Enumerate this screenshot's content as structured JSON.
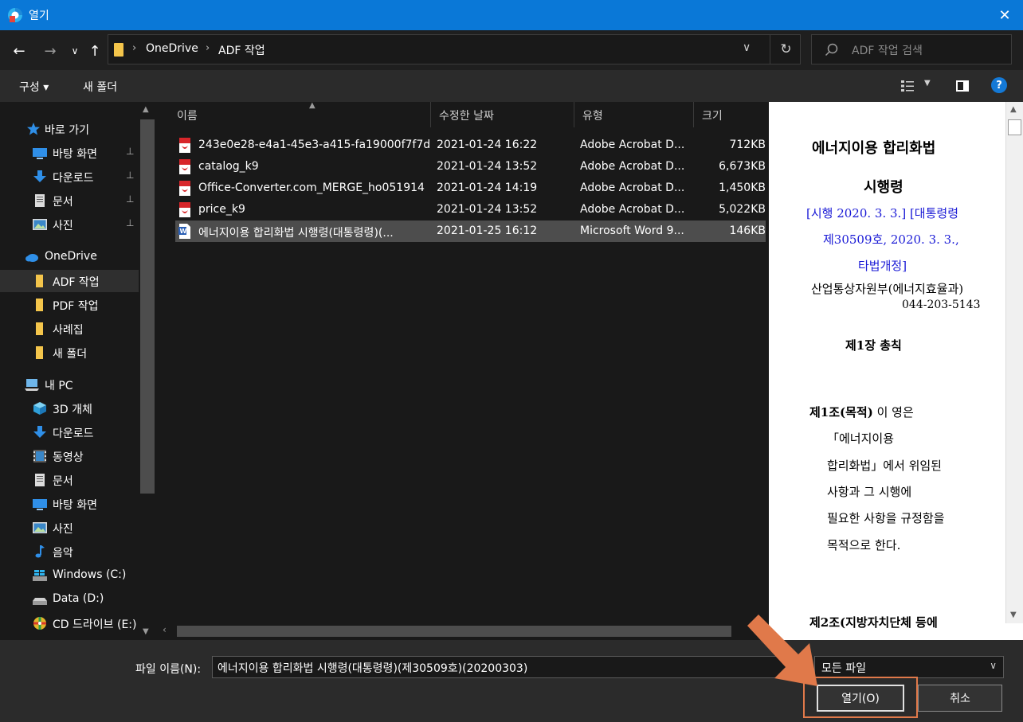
{
  "window": {
    "title": "열기",
    "close_glyph": "✕"
  },
  "nav": {
    "back_glyph": "←",
    "forward_glyph": "→",
    "recent_glyph": "∨",
    "up_glyph": "↑",
    "breadcrumbs": [
      "OneDrive",
      "ADF 작업"
    ],
    "crumb_sep": "›",
    "dropdown_glyph": "∨",
    "refresh_glyph": "↻",
    "search_placeholder": "ADF 작업 검색"
  },
  "toolbar": {
    "organize": "구성 ▾",
    "new_folder": "새 폴더",
    "help": "?"
  },
  "sidebar": {
    "quick_access": "바로 가기",
    "quick_items": [
      {
        "label": "바탕 화면",
        "pinned": true
      },
      {
        "label": "다운로드",
        "pinned": true
      },
      {
        "label": "문서",
        "pinned": true
      },
      {
        "label": "사진",
        "pinned": true
      }
    ],
    "pin_glyph": "📌",
    "onedrive": "OneDrive",
    "onedrive_items": [
      "ADF 작업",
      "PDF 작업",
      "사례집",
      "새 폴더"
    ],
    "this_pc": "내 PC",
    "pc_items": [
      "3D 개체",
      "다운로드",
      "동영상",
      "문서",
      "바탕 화면",
      "사진",
      "음악",
      "Windows (C:)",
      "Data (D:)",
      "CD 드라이브 (E:)"
    ]
  },
  "columns": {
    "name": "이름",
    "date": "수정한 날짜",
    "type": "유형",
    "size": "크기"
  },
  "files": [
    {
      "name": "243e0e28-e4a1-45e3-a415-fa19000f7f7d...",
      "date": "2021-01-24 16:22",
      "type": "Adobe Acrobat D...",
      "size": "712KB",
      "kind": "pdf",
      "selected": false
    },
    {
      "name": "catalog_k9",
      "date": "2021-01-24 13:52",
      "type": "Adobe Acrobat D...",
      "size": "6,673KB",
      "kind": "pdf",
      "selected": false
    },
    {
      "name": "Office-Converter.com_MERGE_ho051914",
      "date": "2021-01-24 14:19",
      "type": "Adobe Acrobat D...",
      "size": "1,450KB",
      "kind": "pdf",
      "selected": false
    },
    {
      "name": "price_k9",
      "date": "2021-01-24 13:52",
      "type": "Adobe Acrobat D...",
      "size": "5,022KB",
      "kind": "pdf",
      "selected": false
    },
    {
      "name": "에너지이용 합리화법 시행령(대통령령)(...",
      "date": "2021-01-25 16:12",
      "type": "Microsoft Word 9...",
      "size": "146KB",
      "kind": "word",
      "selected": true
    }
  ],
  "preview": {
    "title1": "에너지이용  합리화법",
    "title2": "시행령",
    "meta1": "[시행  2020. 3. 3.] [대통령령",
    "meta2": "제30509호, 2020. 3. 3.,",
    "meta3": "타법개정]",
    "dept": "산업통상자원부(에너지효율과)",
    "phone": "044-203-5143",
    "chapter": "제1장 총칙",
    "art1_head": "제1조(목적)",
    "art1_rest": " 이  영은",
    "art1_l2": "「에너지이용",
    "art1_l3": "합리화법」에서  위임된",
    "art1_l4": "사항과  그  시행에",
    "art1_l5": "필요한  사항을  규정함을",
    "art1_l6": "목적으로  한다.",
    "art2_head": "제2조(지방자치단체 등에"
  },
  "bottom": {
    "filename_label": "파일 이름(N):",
    "filename_value": "에너지이용 합리화법 시행령(대통령령)(제30509호)(20200303)",
    "filetype_value": "모든 파일",
    "open_button": "열기(O)",
    "cancel_button": "취소"
  },
  "colors": {
    "title_bar": "#0a78d7",
    "annotation": "#e0794a",
    "link_blue": "#1a1ad6"
  }
}
